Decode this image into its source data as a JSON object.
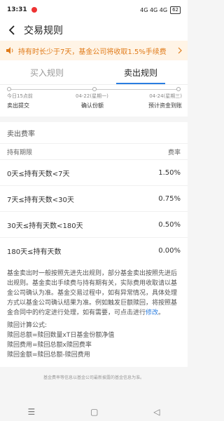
{
  "status": {
    "time": "13:31",
    "signal": "4G 4G 4G",
    "battery": "62"
  },
  "header": {
    "title": "交易规则"
  },
  "notice": {
    "text": "持有时长少于7天，基金公司将收取1.5%手续费"
  },
  "tabs": [
    {
      "label": "买入规则"
    },
    {
      "label": "卖出规则"
    }
  ],
  "timeline": [
    {
      "date": "今日15点前",
      "label": "卖出提交"
    },
    {
      "date": "04-22(星期一)",
      "label": "确认份额"
    },
    {
      "date": "04-24(星期三)",
      "label": "预计资金到账"
    }
  ],
  "fees": {
    "title": "卖出费率",
    "col_period": "持有期限",
    "col_rate": "费率",
    "rows": [
      {
        "period": "0天≤持有天数<7天",
        "rate": "1.50%"
      },
      {
        "period": "7天≤持有天数<30天",
        "rate": "0.75%"
      },
      {
        "period": "30天≤持有天数<180天",
        "rate": "0.50%"
      },
      {
        "period": "180天≤持有天数",
        "rate": "0.00%"
      }
    ]
  },
  "description": {
    "text": "基金卖出时一般按照先进先出规则，部分基金卖出按照先进后出规则。基金卖出手续费与持有期有关，实际费用收取请以基金公司确认为准。基金交易过程中，如有异常情况，具体处理方式以基金公司确认结果为准。例如触发巨额赎回，将按照基金合同中的约定进行处理，如有需要，可点击进行",
    "link": "修改",
    "tail": "。"
  },
  "formula": {
    "title": "赎回计算公式:",
    "lines": [
      "赎回总额=赎回数量xT日基金份额净值",
      "赎回费用=赎回总额x赎回费率",
      "赎回金额=赎回总额-赎回费用"
    ]
  },
  "footer": {
    "text": "基金费率等信息以基金公司最新披露的基金信息为准。"
  },
  "colors": {
    "accent": "#2a7de1",
    "notice_bg": "#fff4e6",
    "notice_text": "#e07b1a"
  }
}
